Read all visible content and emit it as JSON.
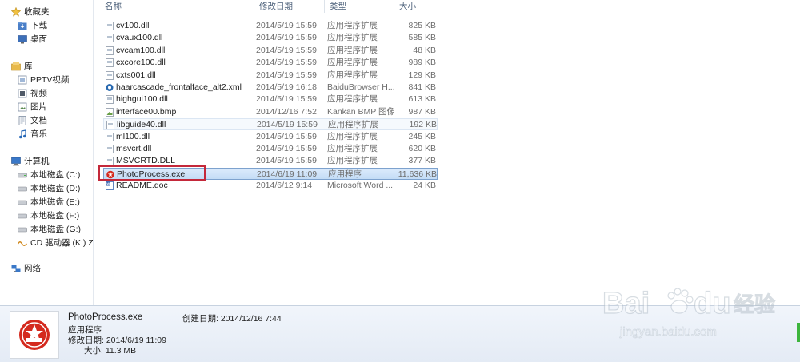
{
  "sidebar": {
    "favorites": {
      "label": "收藏夹",
      "items": [
        {
          "label": "下载"
        },
        {
          "label": "桌面"
        }
      ]
    },
    "library": {
      "label": "库",
      "items": [
        {
          "label": "PPTV视频"
        },
        {
          "label": "视频"
        },
        {
          "label": "图片"
        },
        {
          "label": "文档"
        },
        {
          "label": "音乐"
        }
      ]
    },
    "computer": {
      "label": "计算机",
      "items": [
        {
          "label": "本地磁盘 (C:)"
        },
        {
          "label": "本地磁盘 (D:)"
        },
        {
          "label": "本地磁盘 (E:)"
        },
        {
          "label": "本地磁盘 (F:)"
        },
        {
          "label": "本地磁盘 (G:)"
        },
        {
          "label": "CD 驱动器 (K:) ZTE"
        }
      ]
    },
    "network": {
      "label": "网络"
    }
  },
  "columns": {
    "name": "名称",
    "date": "修改日期",
    "type": "类型",
    "size": "大小"
  },
  "files": [
    {
      "name": "cv100.dll",
      "date": "2014/5/19 15:59",
      "type": "应用程序扩展",
      "size": "825 KB",
      "icon": "dll-file-icon"
    },
    {
      "name": "cvaux100.dll",
      "date": "2014/5/19 15:59",
      "type": "应用程序扩展",
      "size": "585 KB",
      "icon": "dll-file-icon"
    },
    {
      "name": "cvcam100.dll",
      "date": "2014/5/19 15:59",
      "type": "应用程序扩展",
      "size": "48 KB",
      "icon": "dll-file-icon"
    },
    {
      "name": "cxcore100.dll",
      "date": "2014/5/19 15:59",
      "type": "应用程序扩展",
      "size": "989 KB",
      "icon": "dll-file-icon"
    },
    {
      "name": "cxts001.dll",
      "date": "2014/5/19 15:59",
      "type": "应用程序扩展",
      "size": "129 KB",
      "icon": "dll-file-icon"
    },
    {
      "name": "haarcascade_frontalface_alt2.xml",
      "date": "2014/5/19 16:18",
      "type": "BaiduBrowser H...",
      "size": "841 KB",
      "icon": "xml-file-icon"
    },
    {
      "name": "highgui100.dll",
      "date": "2014/5/19 15:59",
      "type": "应用程序扩展",
      "size": "613 KB",
      "icon": "dll-file-icon"
    },
    {
      "name": "interface00.bmp",
      "date": "2014/12/16 7:52",
      "type": "Kankan BMP 图像",
      "size": "987 KB",
      "icon": "bmp-file-icon"
    },
    {
      "name": "libguide40.dll",
      "date": "2014/5/19 15:59",
      "type": "应用程序扩展",
      "size": "192 KB",
      "icon": "dll-file-icon"
    },
    {
      "name": "ml100.dll",
      "date": "2014/5/19 15:59",
      "type": "应用程序扩展",
      "size": "245 KB",
      "icon": "dll-file-icon"
    },
    {
      "name": "msvcrt.dll",
      "date": "2014/5/19 15:59",
      "type": "应用程序扩展",
      "size": "620 KB",
      "icon": "dll-file-icon"
    },
    {
      "name": "MSVCRTD.DLL",
      "date": "2014/5/19 15:59",
      "type": "应用程序扩展",
      "size": "377 KB",
      "icon": "dll-file-icon"
    },
    {
      "name": "PhotoProcess.exe",
      "date": "2014/6/19 11:09",
      "type": "应用程序",
      "size": "11,636 KB",
      "icon": "exe-app-icon"
    },
    {
      "name": "README.doc",
      "date": "2014/6/12 9:14",
      "type": "Microsoft Word ...",
      "size": "24 KB",
      "icon": "word-doc-icon"
    }
  ],
  "details": {
    "filename": "PhotoProcess.exe",
    "type": "应用程序",
    "modified": "修改日期: 2014/6/19 11:09",
    "size": "大小: 11.3 MB",
    "created": "创建日期: 2014/12/16 7:44"
  },
  "watermark": {
    "brand": "Bai",
    "brand2": "du",
    "cn": "经验",
    "url": "jingyan.baidu.com"
  },
  "colors": {
    "selection_border": "#7da2ce",
    "annotation_red": "#c4283a",
    "folder_yellow": "#e8b94a"
  }
}
